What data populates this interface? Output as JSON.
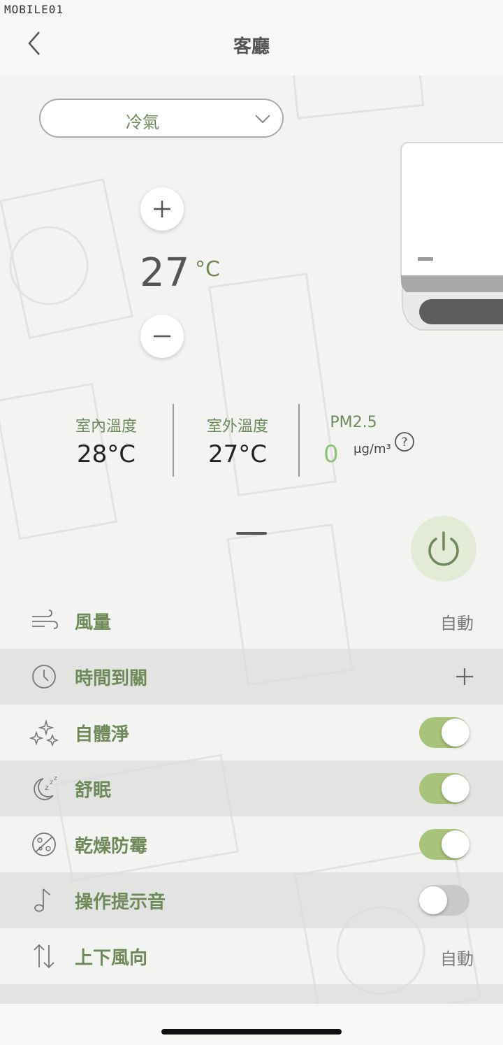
{
  "watermark": "MOBILE01",
  "header": {
    "title": "客廳"
  },
  "mode": {
    "selected": "冷氣"
  },
  "temperature": {
    "value": "27",
    "unit": "°C"
  },
  "stats": {
    "indoor": {
      "label": "室內溫度",
      "value": "28°C"
    },
    "outdoor": {
      "label": "室外溫度",
      "value": "27°C"
    },
    "pm25": {
      "label": "PM2.5",
      "value": "0",
      "unit": "μg/m³"
    }
  },
  "settings": [
    {
      "label": "風量",
      "value": "自動",
      "icon": "wind-icon"
    },
    {
      "label": "時間到關",
      "icon": "clock-icon"
    },
    {
      "label": "自體淨",
      "toggle": true,
      "icon": "sparkle-icon"
    },
    {
      "label": "舒眠",
      "toggle": true,
      "icon": "sleep-icon"
    },
    {
      "label": "乾燥防霉",
      "toggle": true,
      "icon": "mold-icon"
    },
    {
      "label": "操作提示音",
      "toggle": false,
      "icon": "music-note-icon"
    },
    {
      "label": "上下風向",
      "value": "自動",
      "icon": "vertical-swing-icon"
    }
  ],
  "colors": {
    "accent": "#6e8a5a",
    "toggle_on": "#a8c47a",
    "pm_good": "#8fc17a",
    "power_bg": "#e3ebd6"
  }
}
